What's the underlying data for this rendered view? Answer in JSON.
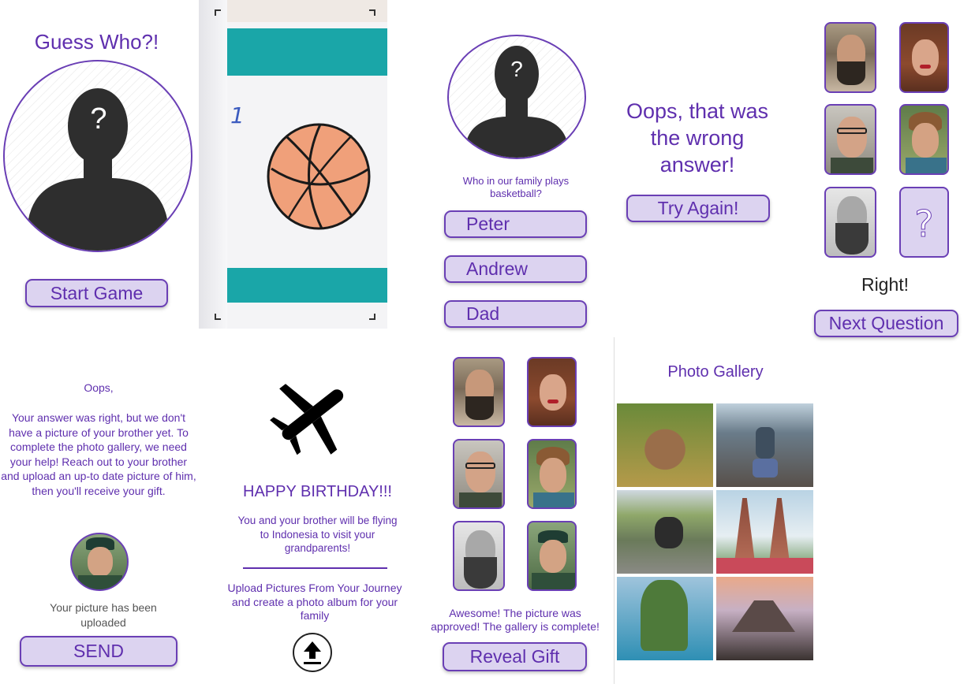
{
  "screen1": {
    "title": "Guess Who?!",
    "question_mark": "?",
    "start_button": "Start Game"
  },
  "screen2": {
    "card_number": "1"
  },
  "screen3": {
    "question_mark": "?",
    "question": "Who in our family plays basketball?",
    "options": [
      "Peter",
      "Andrew",
      "Dad"
    ]
  },
  "screen4": {
    "message": "Oops, that was the wrong answer!",
    "try_again_button": "Try Again!"
  },
  "screen5": {
    "missing_mark": "?",
    "result": "Right!",
    "next_button": "Next Question"
  },
  "screen6": {
    "heading": "Oops,",
    "body": "Your answer was right, but we don't have a picture of your brother yet. To complete the photo gallery, we need your help! Reach out to your brother and upload an up-to date picture of him, then you'll receive your gift.",
    "status": "Your picture has been uploaded",
    "send_button": "SEND"
  },
  "screen7": {
    "title": "HAPPY BIRTHDAY!!!",
    "message": "You and your brother will be flying to Indonesia to visit your grandparents!",
    "upload_prompt": "Upload Pictures From Your Journey and create a photo album for your family"
  },
  "screen8": {
    "message": "Awesome! The picture was approved! The gallery is complete!",
    "reveal_button": "Reveal Gift"
  },
  "screen9": {
    "title": "Photo Gallery"
  },
  "colors": {
    "accent": "#5f2fae",
    "button_fill": "#dcd3f0",
    "silhouette": "#2e2e2e",
    "teal": "#1aa6a8",
    "ball": "#f0a07a"
  },
  "icons": [
    "airplane-icon",
    "upload-icon",
    "question-mark-icon",
    "person-silhouette-icon"
  ]
}
